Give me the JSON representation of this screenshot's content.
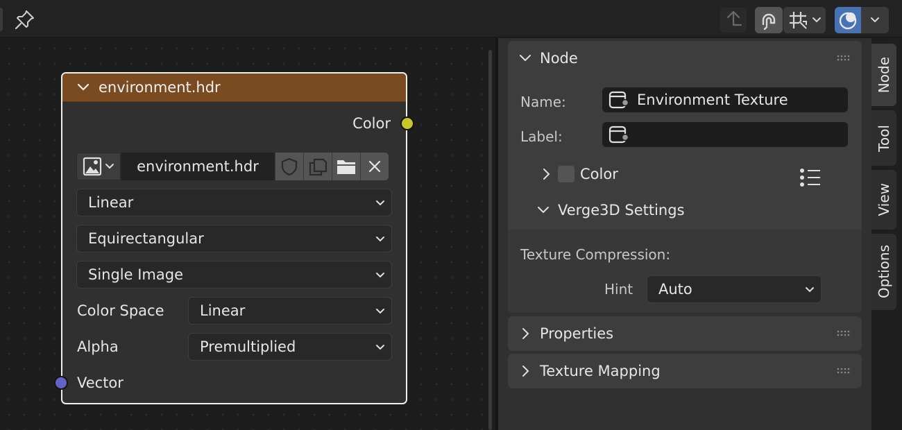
{
  "node": {
    "title": "environment.hdr",
    "output_color": "Color",
    "image_name": "environment.hdr",
    "interpolation": "Linear",
    "projection": "Equirectangular",
    "source": "Single Image",
    "color_space_label": "Color Space",
    "color_space_value": "Linear",
    "alpha_label": "Alpha",
    "alpha_value": "Premultiplied",
    "input_vector": "Vector",
    "header_color": "#7a4a20"
  },
  "sidebar": {
    "node_section": {
      "title": "Node",
      "name_label": "Name:",
      "name_value": "Environment Texture",
      "label_label": "Label:",
      "label_value": "",
      "color_label": "Color",
      "verge_title": "Verge3D Settings",
      "compression_label": "Texture Compression:",
      "hint_label": "Hint",
      "hint_value": "Auto"
    },
    "properties_title": "Properties",
    "mapping_title": "Texture Mapping"
  },
  "tabs": {
    "node": "Node",
    "tool": "Tool",
    "view": "View",
    "options": "Options"
  },
  "colors": {
    "accent_blue": "#4772b3",
    "socket_yellow": "#c7c729",
    "socket_purple": "#6363c7"
  }
}
